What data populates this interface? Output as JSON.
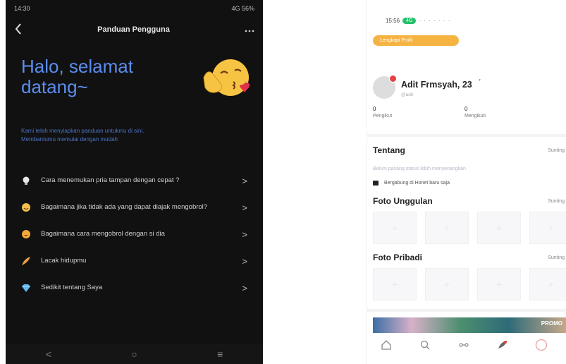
{
  "left": {
    "status_time": "14:30",
    "status_right": "4G 56%",
    "appbar": {
      "back_icon": "chevron-left-icon",
      "title": "Panduan Pengguna",
      "more_icon": "more-dots-icon"
    },
    "hero": {
      "title": "Halo, selamat datang~",
      "subtitle": "Kami telah menyiapkan panduan untukmu di sini. Membantumu memulai dengan mudah",
      "emoji_icon": "kissing-face-emoji"
    },
    "menu": [
      {
        "icon": "lightbulb-icon",
        "label": "Cara menemukan pria tampan dengan cepat ?",
        "color": "#e8e8e8"
      },
      {
        "icon": "smile-face-icon",
        "label": "Bagaimana jika tidak ada yang dapat diajak mengobrol?",
        "color": "#f2c14e"
      },
      {
        "icon": "grin-face-icon",
        "label": "Bagaimana cara mengobrol dengan si dia",
        "color": "#f2a93b"
      },
      {
        "icon": "feather-icon",
        "label": "Lacak hidupmu",
        "color": "#e8a04a"
      },
      {
        "icon": "diamond-icon",
        "label": "Sedikit tentang Saya",
        "color": "#5fb8f0"
      }
    ],
    "navbar": {
      "back": "<",
      "home": "○",
      "recents": "≡"
    }
  },
  "right": {
    "status_time": "15:56",
    "status_badge": "4G",
    "status_icons": "· · · · · · ·",
    "tag": "Lengkapi Profil",
    "profile": {
      "name": "Adit Frmsyah, 23",
      "id": "@adit"
    },
    "stats": [
      {
        "num": "0",
        "label": "Pengikut"
      },
      {
        "num": "0",
        "label": "Mengikuti"
      }
    ],
    "about": {
      "title": "Tentang",
      "edit": "Sunting",
      "bio": "Belum pasang status lebih menyenangkan",
      "joined": "Bergabung di Honet baru saja"
    },
    "featured": {
      "title": "Foto Unggulan",
      "edit": "Sunting"
    },
    "private": {
      "title": "Foto Pribadi",
      "edit": "Sunting"
    },
    "ad_text": "PROMO",
    "tabs": [
      "home-icon",
      "search-icon",
      "chat-icon",
      "moment-icon",
      "profile-icon"
    ],
    "accent": "#f5b342"
  }
}
